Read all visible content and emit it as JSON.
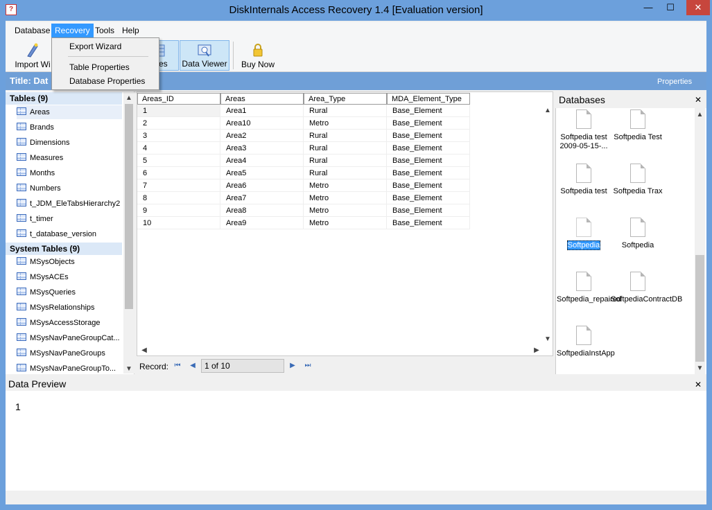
{
  "window": {
    "title": "DiskInternals Access Recovery 1.4 [Evaluation version]",
    "app_icon_glyph": "?",
    "minimize": "—",
    "maximize": "☐",
    "close": "✕"
  },
  "menubar": {
    "items": [
      "Database",
      "Recovery",
      "Tools",
      "Help"
    ],
    "active": "Recovery"
  },
  "recovery_menu": {
    "items": [
      "Export Wizard",
      "Table Properties",
      "Database Properties"
    ]
  },
  "toolbar": {
    "import_label": "Import Wi",
    "databases_label": "ases",
    "data_viewer_label": "Data Viewer",
    "buy_now_label": "Buy Now"
  },
  "titleband": {
    "title": "Title: Dat",
    "properties": "Properties"
  },
  "tables_panel": {
    "tables_header": "Tables (9)",
    "tables": [
      "Areas",
      "Brands",
      "Dimensions",
      "Measures",
      "Months",
      "Numbers",
      "t_JDM_EleTabsHierarchy2",
      "t_timer",
      "t_database_version"
    ],
    "selected_table": "Areas",
    "system_header": "System Tables (9)",
    "system_tables": [
      "MSysObjects",
      "MSysACEs",
      "MSysQueries",
      "MSysRelationships",
      "MSysAccessStorage",
      "MSysNavPaneGroupCat...",
      "MSysNavPaneGroups",
      "MSysNavPaneGroupTo..."
    ]
  },
  "grid": {
    "columns": [
      "Areas_ID",
      "Areas",
      "Area_Type",
      "MDA_Element_Type"
    ],
    "rows": [
      [
        "1",
        "Area1",
        "Rural",
        "Base_Element"
      ],
      [
        "2",
        "Area10",
        "Metro",
        "Base_Element"
      ],
      [
        "3",
        "Area2",
        "Rural",
        "Base_Element"
      ],
      [
        "4",
        "Area3",
        "Rural",
        "Base_Element"
      ],
      [
        "5",
        "Area4",
        "Rural",
        "Base_Element"
      ],
      [
        "6",
        "Area5",
        "Rural",
        "Base_Element"
      ],
      [
        "7",
        "Area6",
        "Metro",
        "Base_Element"
      ],
      [
        "8",
        "Area7",
        "Metro",
        "Base_Element"
      ],
      [
        "9",
        "Area8",
        "Metro",
        "Base_Element"
      ],
      [
        "10",
        "Area9",
        "Metro",
        "Base_Element"
      ]
    ]
  },
  "record_nav": {
    "label": "Record:",
    "position": "1 of 10",
    "first": "⏮",
    "prev": "◀",
    "next": "▶",
    "last": "⏭"
  },
  "databases_panel": {
    "title": "Databases",
    "close": "✕",
    "items": [
      "Softpedia test 2009-05-15-...",
      "Softpedia Test",
      "Softpedia test",
      "Softpedia Trax",
      "Softpedia",
      "Softpedia",
      "Softpedia_repaired",
      "SoftpediaContractDB",
      "SoftpediaInstApp"
    ],
    "selected": "Softpedia"
  },
  "data_preview": {
    "title": "Data Preview",
    "close": "✕",
    "value": "1"
  },
  "scroll": {
    "up": "▲",
    "down": "▼",
    "left": "◀",
    "right": "▶"
  },
  "colors": {
    "frame": "#6ca0dc",
    "selection": "#3399ff",
    "titleband": "#6f9fd7"
  }
}
